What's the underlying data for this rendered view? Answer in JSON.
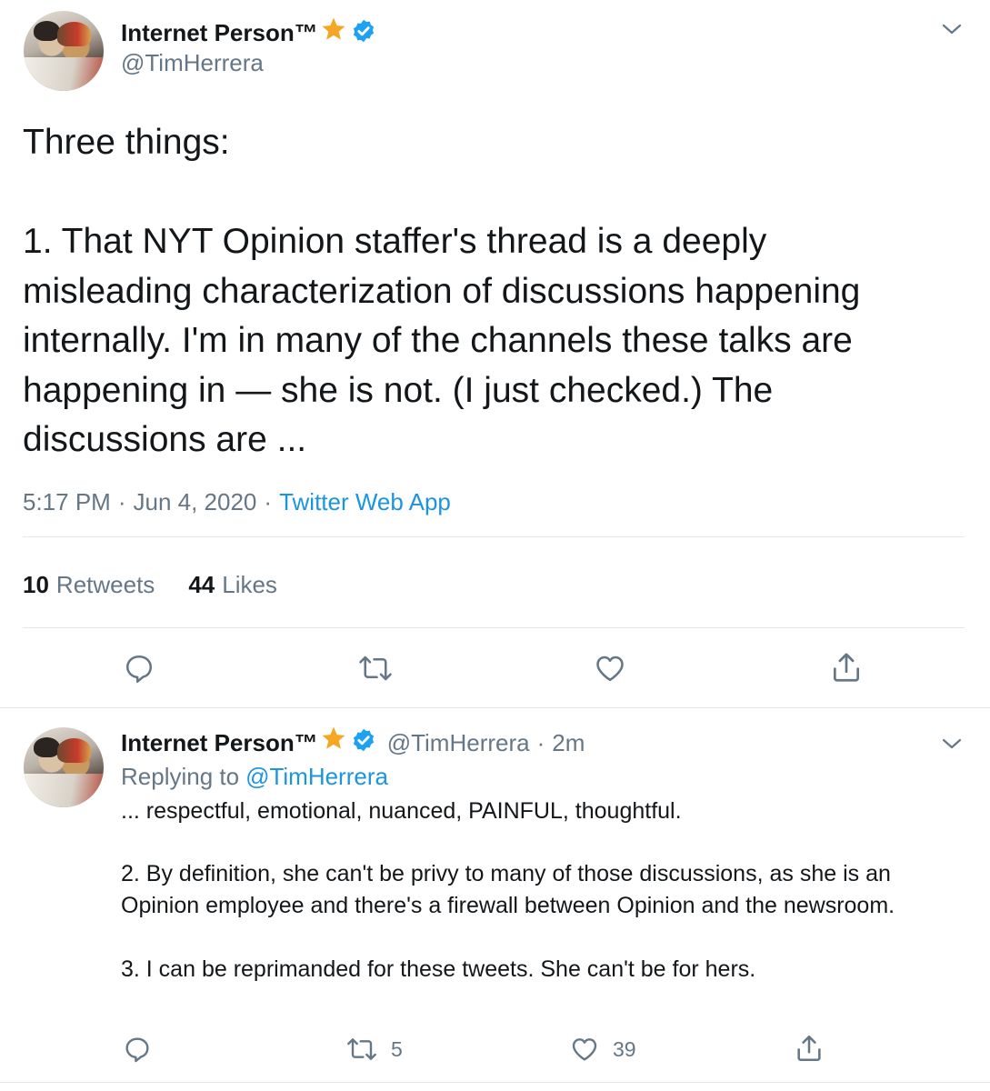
{
  "main_tweet": {
    "display_name": "Internet Person™",
    "handle": "@TimHerrera",
    "text": "Three things:\n\n1. That NYT Opinion staffer's thread is a deeply misleading characterization of discussions happening internally. I'm in many of the channels these talks are happening in — she is not. (I just checked.) The discussions are ...",
    "time": "5:17 PM",
    "separator": "·",
    "date": "Jun 4, 2020",
    "source": "Twitter Web App",
    "retweets_count": "10",
    "retweets_label": "Retweets",
    "likes_count": "44",
    "likes_label": "Likes"
  },
  "reply_tweet": {
    "display_name": "Internet Person™",
    "handle": "@TimHerrera",
    "separator": "·",
    "age": "2m",
    "replying_label": "Replying to",
    "replying_handle": "@TimHerrera",
    "text": "... respectful, emotional, nuanced, PAINFUL, thoughtful.\n\n2. By definition, she can't be privy to many of those discussions, as she is an Opinion employee and there's a firewall between Opinion and the newsroom.\n\n3. I can be reprimanded for these tweets. She can't be for hers.",
    "retweet_count": "5",
    "like_count": "39"
  },
  "icons": {
    "star": "star-icon",
    "verified": "verified-badge-icon",
    "more": "chevron-down-icon",
    "reply": "reply-icon",
    "retweet": "retweet-icon",
    "like": "heart-icon",
    "share": "share-icon"
  },
  "colors": {
    "text": "#14171a",
    "secondary": "#657786",
    "link": "#1b95e0",
    "verified": "#1da1f2",
    "star": "#f5a623",
    "divider": "#e1e8ed"
  }
}
